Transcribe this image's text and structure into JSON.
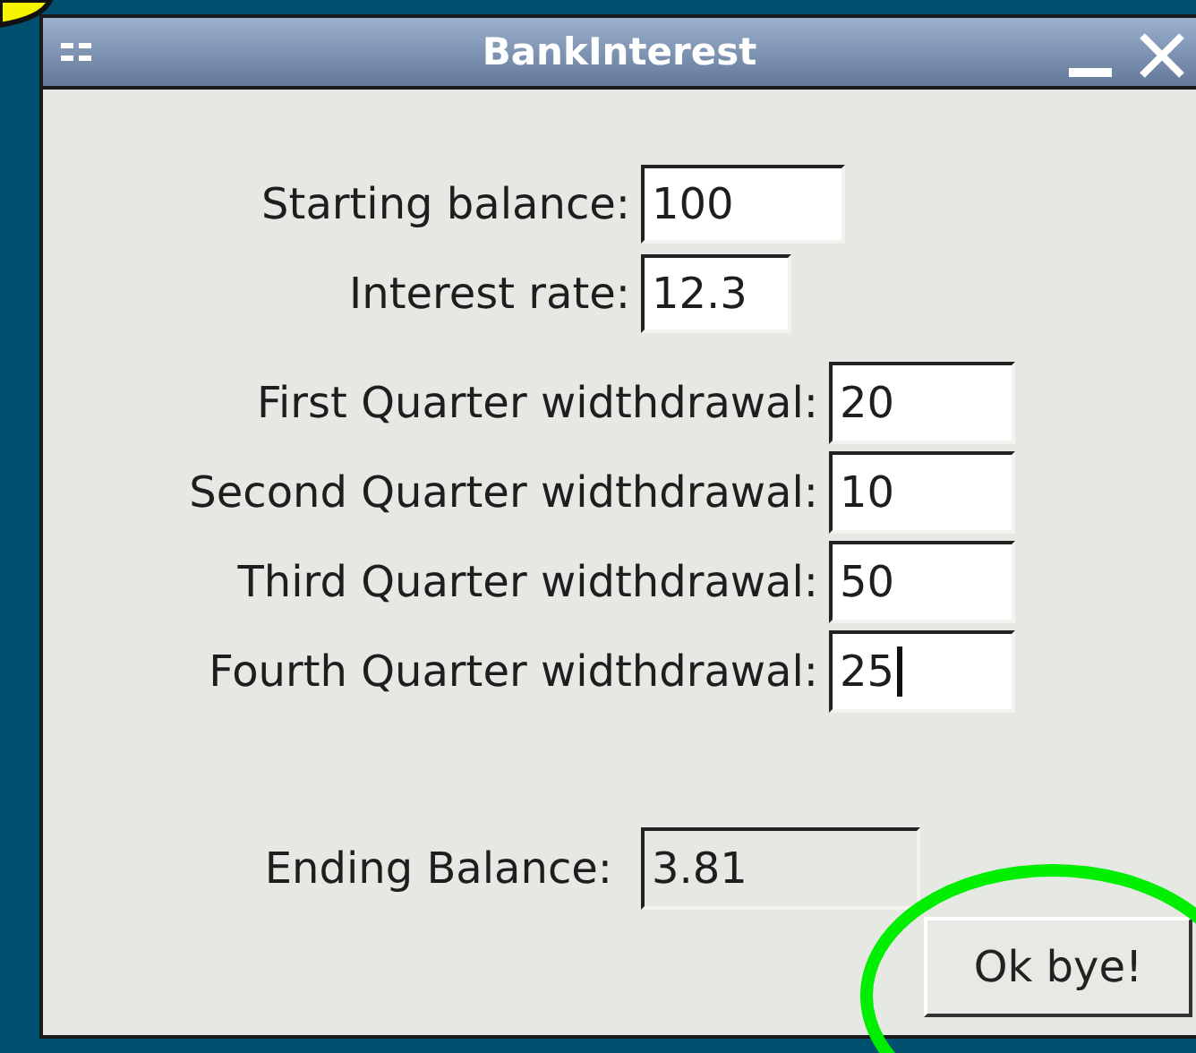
{
  "window": {
    "title": "BankInterest"
  },
  "account_fields": [
    {
      "label": "Starting balance:",
      "value": "100",
      "focused": false,
      "editable": true
    },
    {
      "label": "Interest rate:",
      "value": "12.3",
      "focused": false,
      "editable": true
    }
  ],
  "withdrawal_fields": [
    {
      "label": "First Quarter widthdrawal:",
      "value": "20",
      "focused": false,
      "editable": true
    },
    {
      "label": "Second Quarter widthdrawal:",
      "value": "10",
      "focused": false,
      "editable": true
    },
    {
      "label": "Third Quarter widthdrawal:",
      "value": "50",
      "focused": false,
      "editable": true
    },
    {
      "label": "Fourth Quarter widthdrawal:",
      "value": "25",
      "focused": true,
      "editable": true
    }
  ],
  "result_field": {
    "label": "Ending Balance:",
    "value": "3.81",
    "focused": false,
    "editable": false
  },
  "buttons": [
    "Ok bye!"
  ]
}
